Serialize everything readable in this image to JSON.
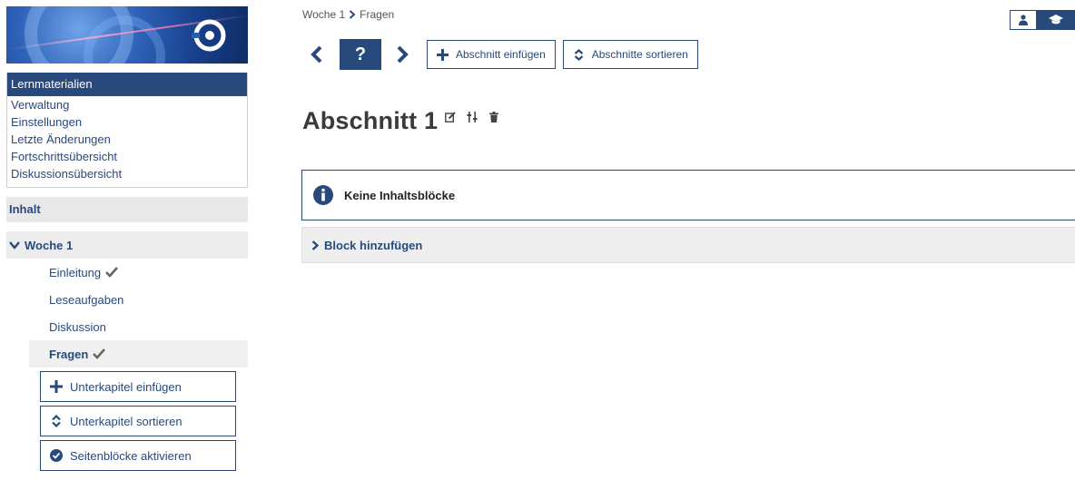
{
  "sidebar": {
    "menu": {
      "header": "Lernmaterialien",
      "links": [
        "Verwaltung",
        "Einstellungen",
        "Letzte Änderungen",
        "Fortschrittsübersicht",
        "Diskussionsübersicht"
      ]
    },
    "content_header": "Inhalt",
    "week": {
      "label": "Woche 1",
      "items": [
        {
          "label": "Einleitung",
          "completed": true
        },
        {
          "label": "Leseaufgaben",
          "completed": false
        },
        {
          "label": "Diskussion",
          "completed": false
        },
        {
          "label": "Fragen",
          "completed": true,
          "active": true
        }
      ]
    },
    "buttons": {
      "add_subchapter": "Unterkapitel einfügen",
      "sort_subchapters": "Unterkapitel sortieren",
      "activate_page_blocks": "Seitenblöcke aktivieren"
    }
  },
  "breadcrumb": {
    "parent": "Woche 1",
    "current": "Fragen"
  },
  "toolbar": {
    "current_marker": "?",
    "add_section": "Abschnitt einfügen",
    "sort_sections": "Abschnitte sortieren"
  },
  "section": {
    "title": "Abschnitt 1",
    "empty_message": "Keine Inhaltsblöcke",
    "add_block": "Block hinzufügen"
  },
  "colors": {
    "primary": "#28497c",
    "panel": "#eeeeee",
    "title": "#3a3a3a"
  }
}
